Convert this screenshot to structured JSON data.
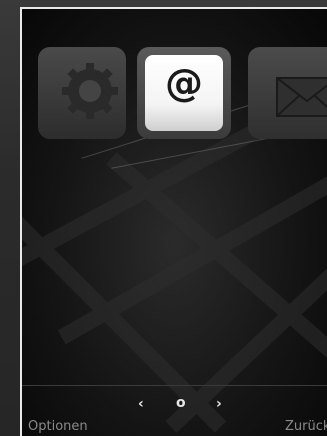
{
  "home": {
    "icons": [
      {
        "name": "settings",
        "icon": "gear-icon",
        "selected": false
      },
      {
        "name": "email",
        "icon": "at-icon",
        "glyph": "@",
        "selected": true
      },
      {
        "name": "messages",
        "icon": "envelope-icon",
        "selected": false
      }
    ]
  },
  "pager": {
    "prev": "‹",
    "current": "o",
    "next": "›"
  },
  "softkeys": {
    "left": "Optionen",
    "right": "Zurück"
  },
  "colors": {
    "screen_border": "#e9e9e9",
    "softkey_text": "#8a8a8a"
  }
}
